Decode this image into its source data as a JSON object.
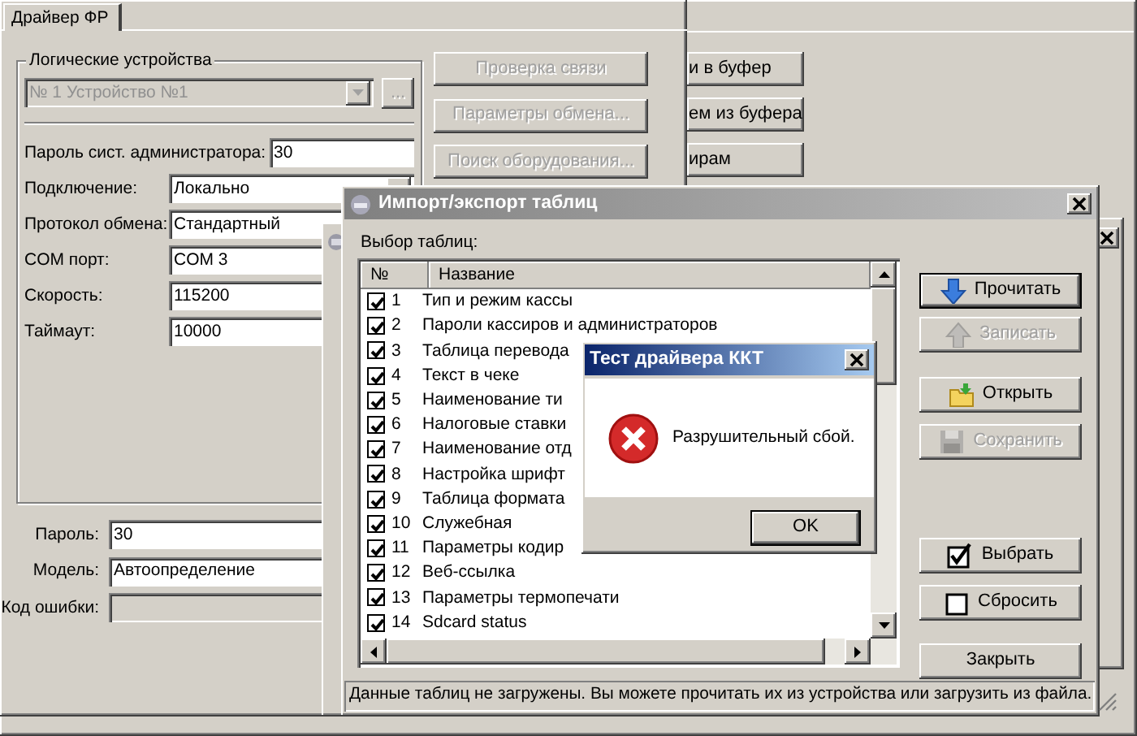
{
  "back_window": {
    "buttons": [
      {
        "label": "и в буфер"
      },
      {
        "label": "ем из буфера"
      },
      {
        "label": "ирам"
      }
    ]
  },
  "main_window": {
    "tabs": [
      {
        "label": "Драйвер ФР",
        "selected": true
      }
    ],
    "device_group": {
      "title": "Логические устройства",
      "device": {
        "value": "№ 1 Устройство №1",
        "disabled": true
      },
      "browse_button": "...",
      "fields": [
        {
          "label": "Пароль сист. администратора:",
          "value": "30",
          "kind": "input"
        },
        {
          "label": "Подключение:",
          "value": "Локально",
          "kind": "combo"
        },
        {
          "label": "Протокол обмена:",
          "value": "Стандартный",
          "kind": "input"
        },
        {
          "label": "COM порт:",
          "value": "COM 3",
          "kind": "input"
        },
        {
          "label": "Скорость:",
          "value": "115200",
          "kind": "input"
        },
        {
          "label": "Таймаут:",
          "value": "10000",
          "kind": "input"
        }
      ]
    },
    "actions": [
      {
        "label": "Проверка связи",
        "disabled": true
      },
      {
        "label": "Параметры обмена...",
        "disabled": true
      },
      {
        "label": "Поиск оборудования...",
        "disabled": true
      }
    ],
    "bottom_fields": [
      {
        "label": "Пароль:",
        "value": "30",
        "disabled": false
      },
      {
        "label": "Модель:",
        "value": "Автоопределение",
        "disabled": false
      },
      {
        "label": "Код ошибки:",
        "disabled": true
      }
    ]
  },
  "import_dialog": {
    "title": "Импорт/экспорт таблиц",
    "active": false,
    "list_label": "Выбор таблиц:",
    "columns": [
      "№",
      "Название"
    ],
    "rows": [
      {
        "number": "1",
        "name": "Тип и режим кассы",
        "checked": true
      },
      {
        "number": "2",
        "name": "Пароли кассиров и администраторов",
        "checked": true
      },
      {
        "number": "3",
        "name": "Таблица перевода",
        "checked": true
      },
      {
        "number": "4",
        "name": "Текст в чеке",
        "checked": true
      },
      {
        "number": "5",
        "name": "Наименование ти",
        "checked": true
      },
      {
        "number": "6",
        "name": "Налоговые ставки",
        "checked": true
      },
      {
        "number": "7",
        "name": "Наименование отд",
        "checked": true
      },
      {
        "number": "8",
        "name": "Настройка шрифт",
        "checked": true
      },
      {
        "number": "9",
        "name": "Таблица формата",
        "checked": true
      },
      {
        "number": "10",
        "name": "Служебная",
        "checked": true
      },
      {
        "number": "11",
        "name": "Параметры кодир",
        "checked": true
      },
      {
        "number": "12",
        "name": "Веб-ссылка",
        "checked": true
      },
      {
        "number": "13",
        "name": "Параметры термопечати",
        "checked": true
      },
      {
        "number": "14",
        "name": "Sdcard status",
        "checked": true
      }
    ],
    "buttons": [
      {
        "label": "Прочитать",
        "disabled": false,
        "default": true
      },
      {
        "label": "Записать",
        "disabled": true,
        "default": false
      },
      {
        "label": "Открыть",
        "disabled": false,
        "default": false
      },
      {
        "label": "Сохранить",
        "disabled": true,
        "default": false
      },
      {
        "label": "Выбрать",
        "disabled": false,
        "default": false
      },
      {
        "label": "Сбросить",
        "disabled": false,
        "default": false
      },
      {
        "label": "Закрыть",
        "disabled": false,
        "default": false
      }
    ],
    "status": "Данные таблиц не загружены. Вы можете прочитать их из устройства или загрузить из файла."
  },
  "message_box": {
    "title": "Тест драйвера ККТ",
    "active": true,
    "message": "Разрушительный сбой.",
    "buttons": [
      {
        "label": "OK"
      }
    ]
  }
}
